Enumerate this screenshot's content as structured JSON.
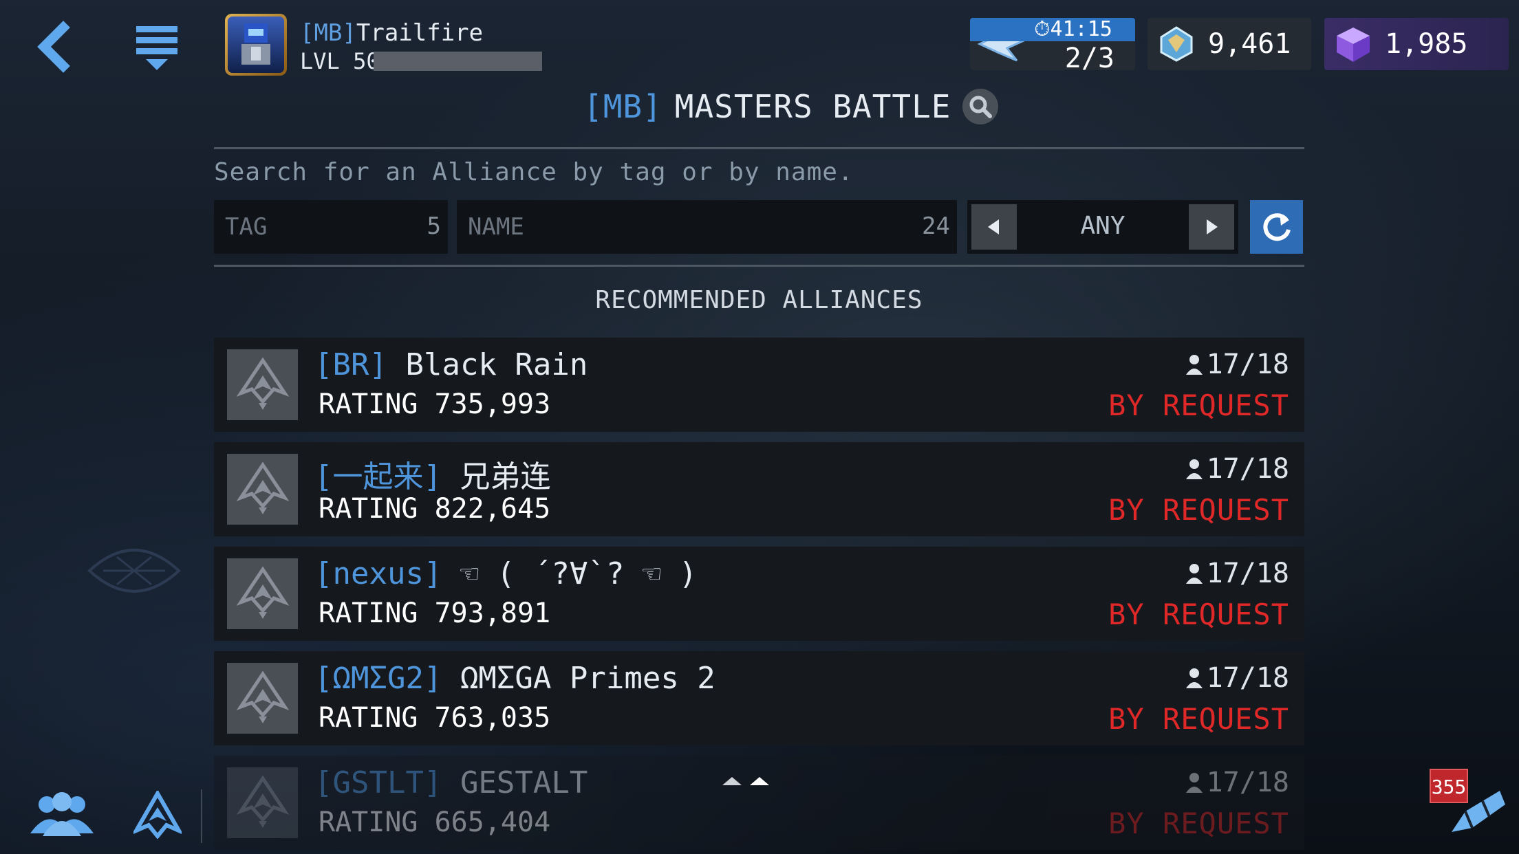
{
  "player": {
    "tag": "[MB]",
    "name": "Trailfire",
    "level_label": "LVL 50",
    "xp_fraction": 0
  },
  "resources": {
    "energy_timer": "41:15",
    "energy_count": "2/3",
    "energon": "9,461",
    "gems": "1,985"
  },
  "title": {
    "tag": "[MB]",
    "name": "MASTERS BATTLE"
  },
  "search": {
    "hint": "Search for an Alliance by tag or by name.",
    "tag_placeholder": "TAG",
    "tag_limit": "5",
    "name_placeholder": "NAME",
    "name_limit": "24",
    "filter_value": "ANY"
  },
  "section_title": "RECOMMENDED ALLIANCES",
  "alliances": [
    {
      "tag": "[BR]",
      "name": "Black Rain",
      "rating": "RATING 735,993",
      "members": "17/18",
      "status": "BY REQUEST"
    },
    {
      "tag": "[一起来]",
      "name": "兄弟连",
      "rating": "RATING 822,645",
      "members": "17/18",
      "status": "BY REQUEST"
    },
    {
      "tag": "[nexus]",
      "name": "☜ ( ´?∀`? ☜ )",
      "rating": "RATING 793,891",
      "members": "17/18",
      "status": "BY REQUEST"
    },
    {
      "tag": "[ΩMΣG2]",
      "name": "ΩMΣGA Primes 2",
      "rating": "RATING 763,035",
      "members": "17/18",
      "status": "BY REQUEST"
    },
    {
      "tag": "[GSTLT]",
      "name": "GESTALT",
      "rating": "RATING 665,404",
      "members": "17/18",
      "status": "BY REQUEST"
    }
  ],
  "chat": {
    "unread": "355"
  },
  "colors": {
    "tag_blue": "#4f95dc",
    "status_red": "#e02828",
    "gem_purple": "#8d5ae0",
    "energy_blue": "#2c72c2"
  },
  "icons": {
    "back": "chevron-left-icon",
    "menu": "menu-icon",
    "search": "search-icon",
    "refresh": "refresh-icon",
    "alliance": "alliance-icon",
    "chat": "chat-icon",
    "member": "person-icon"
  }
}
